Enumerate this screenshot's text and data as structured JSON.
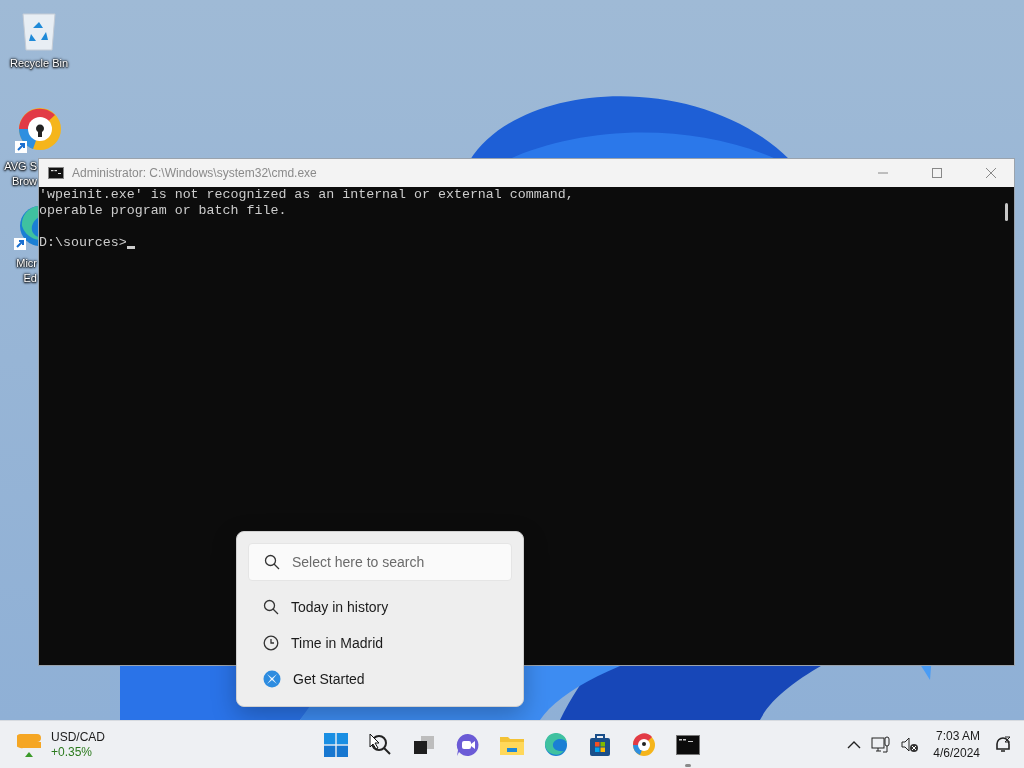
{
  "desktop": {
    "icons": [
      {
        "kind": "recycle",
        "lines": [
          "Recycle Bin"
        ]
      },
      {
        "kind": "avg",
        "lines": [
          "AVG S",
          "Brow"
        ]
      },
      {
        "kind": "edge",
        "lines": [
          "Micr",
          "Ed"
        ]
      }
    ]
  },
  "console_window": {
    "title": "Administrator: C:\\Windows\\system32\\cmd.exe",
    "output": [
      "'wpeinit.exe' is not recognized as an internal or external command,",
      "operable program or batch file."
    ],
    "prompt": "D:\\sources>"
  },
  "search_flyout": {
    "placeholder": "Select here to search",
    "suggestions": [
      {
        "kind": "search",
        "label": "Today in history"
      },
      {
        "kind": "clock",
        "label": "Time in Madrid"
      },
      {
        "kind": "app",
        "label": "Get Started"
      }
    ]
  },
  "taskbar": {
    "widget": {
      "title": "USD/CAD",
      "change": "+0.35%"
    },
    "apps": [
      {
        "kind": "start",
        "running": false
      },
      {
        "kind": "search",
        "running": false
      },
      {
        "kind": "taskview",
        "running": false
      },
      {
        "kind": "chat",
        "running": false
      },
      {
        "kind": "explorer",
        "running": false
      },
      {
        "kind": "edge",
        "running": false
      },
      {
        "kind": "store",
        "running": false
      },
      {
        "kind": "avg",
        "running": false
      },
      {
        "kind": "terminal",
        "running": true
      }
    ],
    "clock": {
      "time": "7:03 AM",
      "date": "4/6/2024"
    }
  }
}
